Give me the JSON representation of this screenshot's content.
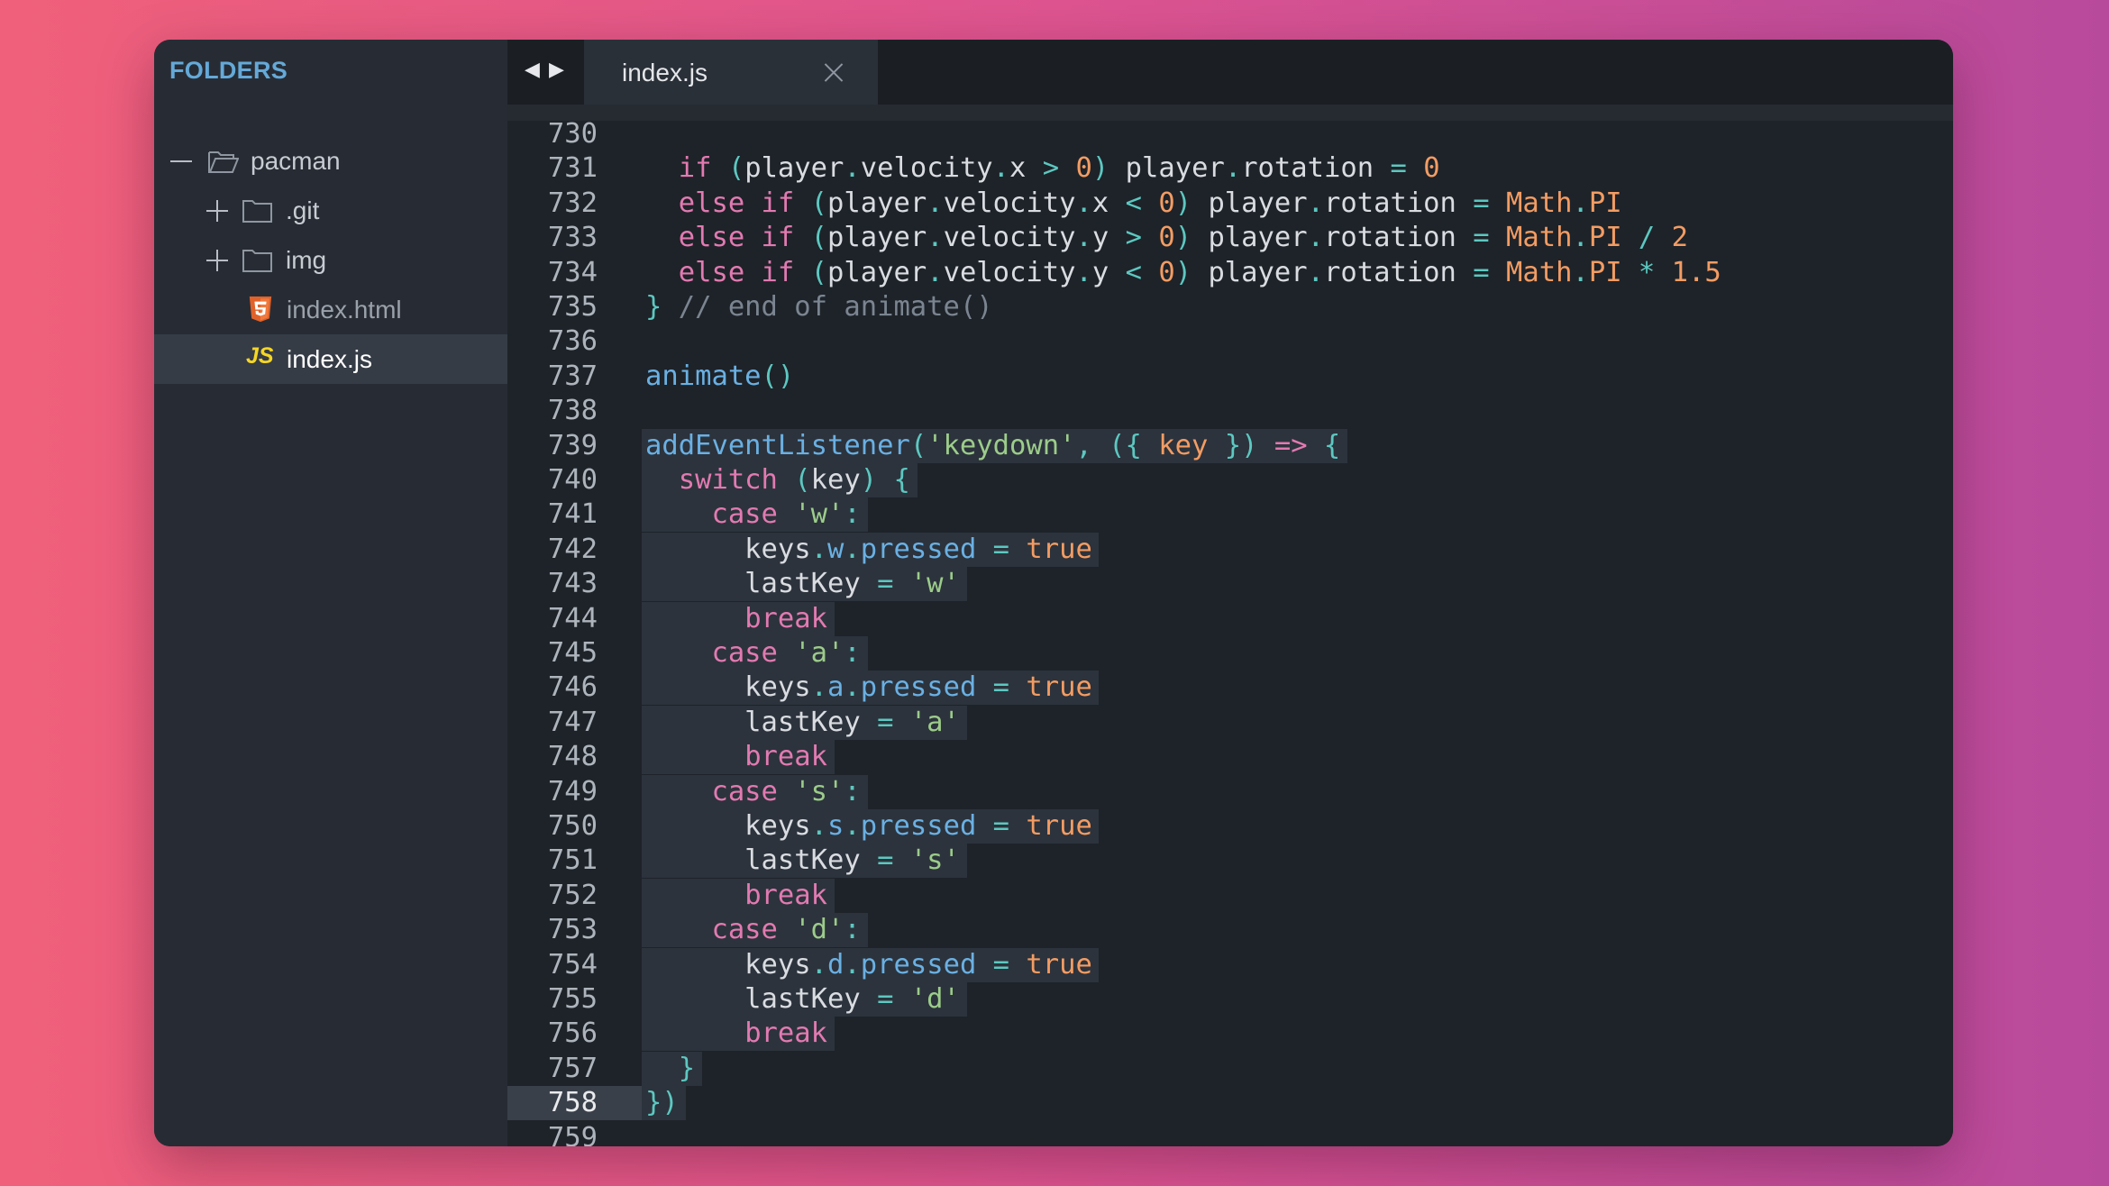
{
  "sidebar": {
    "header": "FOLDERS",
    "items": [
      {
        "label": "pacman",
        "toggle": "minus",
        "icon": "folder-open-icon"
      },
      {
        "label": ".git",
        "toggle": "plus",
        "icon": "folder-icon"
      },
      {
        "label": "img",
        "toggle": "plus",
        "icon": "folder-icon"
      },
      {
        "label": "index.html",
        "icon": "html5-icon"
      },
      {
        "label": "index.js",
        "icon": "js-icon",
        "badge": "JS"
      }
    ]
  },
  "tabbar": {
    "back_arrow": "◀",
    "forward_arrow": "▶",
    "active_tab": "index.js"
  },
  "editor": {
    "line_numbers": [
      "730",
      "731",
      "732",
      "733",
      "734",
      "735",
      "736",
      "737",
      "738",
      "739",
      "740",
      "741",
      "742",
      "743",
      "744",
      "745",
      "746",
      "747",
      "748",
      "749",
      "750",
      "751",
      "752",
      "753",
      "754",
      "755",
      "756",
      "757",
      "758",
      "759"
    ],
    "current_line": "758",
    "lines": [
      [],
      [
        [
          "kw",
          "  if "
        ],
        [
          "punc",
          "("
        ],
        [
          "id",
          "player"
        ],
        [
          "dot",
          "."
        ],
        [
          "id",
          "velocity"
        ],
        [
          "dot",
          "."
        ],
        [
          "id",
          "x "
        ],
        [
          "op",
          "> "
        ],
        [
          "num",
          "0"
        ],
        [
          "punc",
          ") "
        ],
        [
          "id",
          "player"
        ],
        [
          "dot",
          "."
        ],
        [
          "id",
          "rotation "
        ],
        [
          "op",
          "= "
        ],
        [
          "num",
          "0"
        ]
      ],
      [
        [
          "kw",
          "  else if "
        ],
        [
          "punc",
          "("
        ],
        [
          "id",
          "player"
        ],
        [
          "dot",
          "."
        ],
        [
          "id",
          "velocity"
        ],
        [
          "dot",
          "."
        ],
        [
          "id",
          "x "
        ],
        [
          "op",
          "< "
        ],
        [
          "num",
          "0"
        ],
        [
          "punc",
          ") "
        ],
        [
          "id",
          "player"
        ],
        [
          "dot",
          "."
        ],
        [
          "id",
          "rotation "
        ],
        [
          "op",
          "= "
        ],
        [
          "cls",
          "Math"
        ],
        [
          "dot",
          "."
        ],
        [
          "cls",
          "PI"
        ]
      ],
      [
        [
          "kw",
          "  else if "
        ],
        [
          "punc",
          "("
        ],
        [
          "id",
          "player"
        ],
        [
          "dot",
          "."
        ],
        [
          "id",
          "velocity"
        ],
        [
          "dot",
          "."
        ],
        [
          "id",
          "y "
        ],
        [
          "op",
          "> "
        ],
        [
          "num",
          "0"
        ],
        [
          "punc",
          ") "
        ],
        [
          "id",
          "player"
        ],
        [
          "dot",
          "."
        ],
        [
          "id",
          "rotation "
        ],
        [
          "op",
          "= "
        ],
        [
          "cls",
          "Math"
        ],
        [
          "dot",
          "."
        ],
        [
          "cls",
          "PI "
        ],
        [
          "op",
          "/ "
        ],
        [
          "num",
          "2"
        ]
      ],
      [
        [
          "kw",
          "  else if "
        ],
        [
          "punc",
          "("
        ],
        [
          "id",
          "player"
        ],
        [
          "dot",
          "."
        ],
        [
          "id",
          "velocity"
        ],
        [
          "dot",
          "."
        ],
        [
          "id",
          "y "
        ],
        [
          "op",
          "< "
        ],
        [
          "num",
          "0"
        ],
        [
          "punc",
          ") "
        ],
        [
          "id",
          "player"
        ],
        [
          "dot",
          "."
        ],
        [
          "id",
          "rotation "
        ],
        [
          "op",
          "= "
        ],
        [
          "cls",
          "Math"
        ],
        [
          "dot",
          "."
        ],
        [
          "cls",
          "PI "
        ],
        [
          "op",
          "* "
        ],
        [
          "num",
          "1.5"
        ]
      ],
      [
        [
          "punc",
          "} "
        ],
        [
          "com",
          "// end of animate()"
        ]
      ],
      [],
      [
        [
          "fn",
          "animate"
        ],
        [
          "punc",
          "()"
        ]
      ],
      [],
      [
        [
          "fn",
          "addEventListener"
        ],
        [
          "punc",
          "("
        ],
        [
          "str",
          "'keydown'"
        ],
        [
          "punc",
          ", ({ "
        ],
        [
          "num",
          "key"
        ],
        [
          "punc",
          " }) "
        ],
        [
          "kw",
          "=> "
        ],
        [
          "punc",
          "{"
        ]
      ],
      [
        [
          "id",
          "  "
        ],
        [
          "kw",
          "switch "
        ],
        [
          "punc",
          "("
        ],
        [
          "id",
          "key"
        ],
        [
          "punc",
          ") {"
        ]
      ],
      [
        [
          "id",
          "    "
        ],
        [
          "kw",
          "case "
        ],
        [
          "str",
          "'w'"
        ],
        [
          "punc",
          ":"
        ]
      ],
      [
        [
          "id",
          "      keys"
        ],
        [
          "dot",
          "."
        ],
        [
          "prop",
          "w"
        ],
        [
          "dot",
          "."
        ],
        [
          "prop",
          "pressed "
        ],
        [
          "op",
          "= "
        ],
        [
          "num",
          "true"
        ]
      ],
      [
        [
          "id",
          "      lastKey "
        ],
        [
          "op",
          "= "
        ],
        [
          "str",
          "'w'"
        ]
      ],
      [
        [
          "id",
          "      "
        ],
        [
          "kw",
          "break"
        ]
      ],
      [
        [
          "id",
          "    "
        ],
        [
          "kw",
          "case "
        ],
        [
          "str",
          "'a'"
        ],
        [
          "punc",
          ":"
        ]
      ],
      [
        [
          "id",
          "      keys"
        ],
        [
          "dot",
          "."
        ],
        [
          "prop",
          "a"
        ],
        [
          "dot",
          "."
        ],
        [
          "prop",
          "pressed "
        ],
        [
          "op",
          "= "
        ],
        [
          "num",
          "true"
        ]
      ],
      [
        [
          "id",
          "      lastKey "
        ],
        [
          "op",
          "= "
        ],
        [
          "str",
          "'a'"
        ]
      ],
      [
        [
          "id",
          "      "
        ],
        [
          "kw",
          "break"
        ]
      ],
      [
        [
          "id",
          "    "
        ],
        [
          "kw",
          "case "
        ],
        [
          "str",
          "'s'"
        ],
        [
          "punc",
          ":"
        ]
      ],
      [
        [
          "id",
          "      keys"
        ],
        [
          "dot",
          "."
        ],
        [
          "prop",
          "s"
        ],
        [
          "dot",
          "."
        ],
        [
          "prop",
          "pressed "
        ],
        [
          "op",
          "= "
        ],
        [
          "num",
          "true"
        ]
      ],
      [
        [
          "id",
          "      lastKey "
        ],
        [
          "op",
          "= "
        ],
        [
          "str",
          "'s'"
        ]
      ],
      [
        [
          "id",
          "      "
        ],
        [
          "kw",
          "break"
        ]
      ],
      [
        [
          "id",
          "    "
        ],
        [
          "kw",
          "case "
        ],
        [
          "str",
          "'d'"
        ],
        [
          "punc",
          ":"
        ]
      ],
      [
        [
          "id",
          "      keys"
        ],
        [
          "dot",
          "."
        ],
        [
          "prop",
          "d"
        ],
        [
          "dot",
          "."
        ],
        [
          "prop",
          "pressed "
        ],
        [
          "op",
          "= "
        ],
        [
          "num",
          "true"
        ]
      ],
      [
        [
          "id",
          "      lastKey "
        ],
        [
          "op",
          "= "
        ],
        [
          "str",
          "'d'"
        ]
      ],
      [
        [
          "id",
          "      "
        ],
        [
          "kw",
          "break"
        ]
      ],
      [
        [
          "punc",
          "  }"
        ]
      ],
      [
        [
          "punc",
          "})"
        ]
      ],
      []
    ]
  }
}
